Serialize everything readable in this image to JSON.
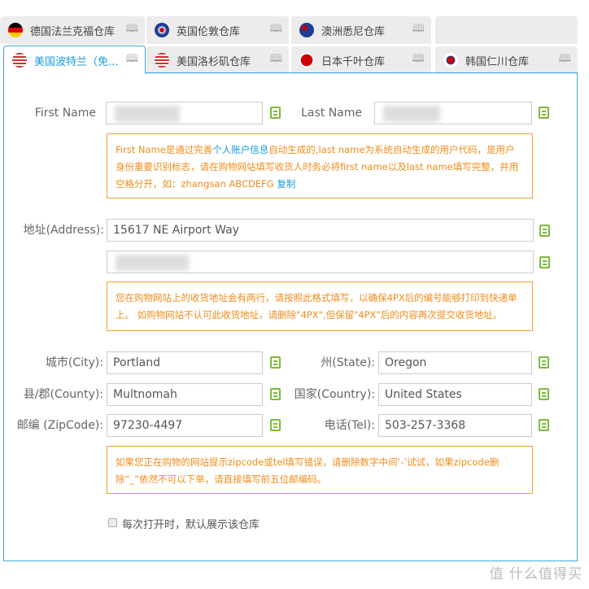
{
  "tabs": [
    {
      "label": "德国法兰克福仓库",
      "flag": "germany",
      "active": false
    },
    {
      "label": "英国伦敦仓库",
      "flag": "uk",
      "active": false
    },
    {
      "label": "澳洲悉尼仓库",
      "flag": "australia",
      "active": false
    },
    {
      "label": "",
      "flag": "",
      "active": false
    },
    {
      "label": "美国波特兰（免...",
      "flag": "usa",
      "active": true
    },
    {
      "label": "美国洛杉矶仓库",
      "flag": "usa",
      "active": false
    },
    {
      "label": "日本千叶仓库",
      "flag": "japan",
      "active": false
    },
    {
      "label": "韩国仁川仓库",
      "flag": "korea",
      "active": false
    }
  ],
  "form": {
    "first_name_label": "First Name",
    "last_name_label": "Last Name",
    "name_note_1": "First Name是通过完善",
    "name_note_link": "个人账户信息",
    "name_note_2": "自动生成的,last name为系统自动生成的用户代码，是用户 身份重要识别标志，请在购物网站填写收货人时务必将first name以及last name填写完整，并用 空格分开，如：zhangsan ABCDEFG ",
    "name_note_copy": "复制",
    "address_label": "地址(Address):",
    "address1": "15617 NE Airport Way",
    "address_note": "您在购物网站上的收货地址会有两行，请按照此格式填写，以确保4PX后的编号能够打印到快递单上。 如购物网站不认可此收货地址，请删除\"4PX\",但保留\"4PX\"后的内容再次提交收货地址。",
    "city_label": "城市(City):",
    "city": "Portland",
    "state_label": "州(State):",
    "state": "Oregon",
    "county_label": "县/郡(County):",
    "county": "Multnomah",
    "country_label": "国家(Country):",
    "country": "United States",
    "zip_label": "邮编 (ZipCode):",
    "zip": "97230-4497",
    "tel_label": "电话(Tel):",
    "tel": "503-257-3368",
    "zip_note": "如果您正在购物的网站提示zipcode或tel填写错误，请删除数字中间‘-’试试，如果zipcode删除“_”依然不可以下单，请直接填写前五位邮编码。",
    "default_checkbox_label": "每次打开时，默认展示该仓库",
    "default_checked": false
  },
  "watermark": "值 什么值得买",
  "colors": {
    "accent": "#1a9bd7",
    "note": "#f08c1a",
    "copy_icon": "#7cba3a"
  }
}
